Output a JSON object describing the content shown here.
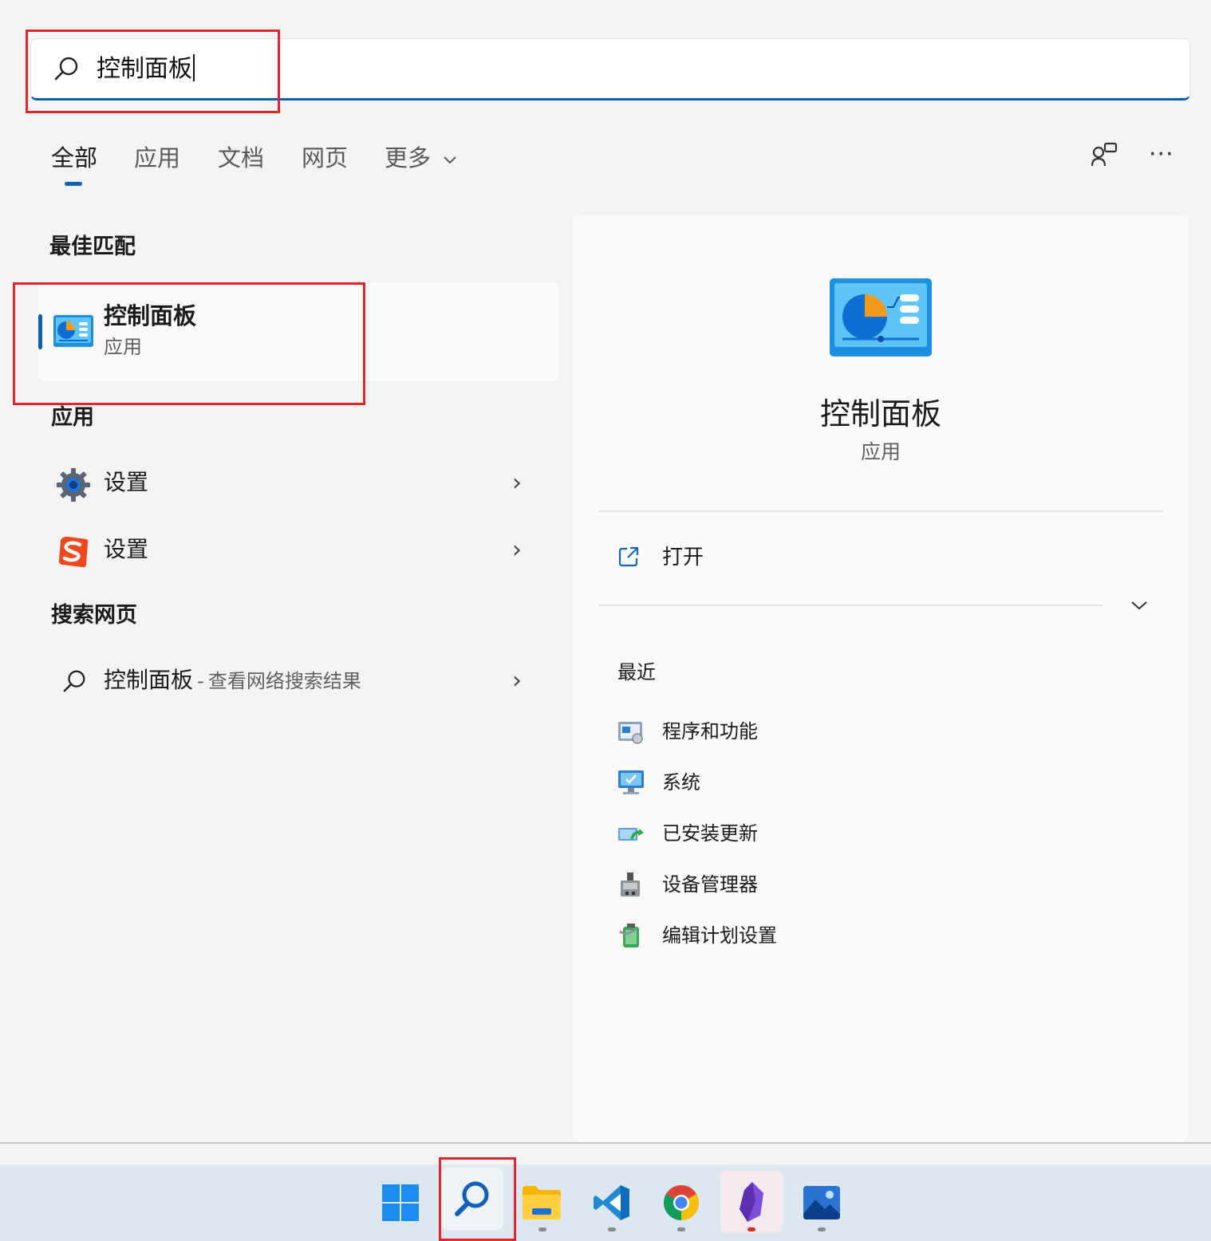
{
  "search": {
    "query": "控制面板"
  },
  "tabs": [
    {
      "label": "全部"
    },
    {
      "label": "应用"
    },
    {
      "label": "文档"
    },
    {
      "label": "网页"
    },
    {
      "label": "更多"
    }
  ],
  "sections": {
    "best_match": "最佳匹配",
    "apps": "应用",
    "web": "搜索网页"
  },
  "best_match": {
    "title": "控制面板",
    "subtitle": "应用"
  },
  "apps": [
    {
      "label": "设置",
      "icon": "settings-gear-icon"
    },
    {
      "label": "设置",
      "icon": "sogou-s-icon"
    }
  ],
  "web_result": {
    "query": "控制面板",
    "separator": "-",
    "suffix": "查看网络搜索结果"
  },
  "detail": {
    "title": "控制面板",
    "subtitle": "应用",
    "open_label": "打开",
    "recent_label": "最近",
    "recent": [
      {
        "label": "程序和功能",
        "icon": "programs-features-icon"
      },
      {
        "label": "系统",
        "icon": "system-monitor-icon"
      },
      {
        "label": "已安装更新",
        "icon": "installed-updates-icon"
      },
      {
        "label": "设备管理器",
        "icon": "device-manager-icon"
      },
      {
        "label": "编辑计划设置",
        "icon": "power-plan-icon"
      }
    ]
  },
  "colors": {
    "accent": "#0f5fb8",
    "annotation": "#e0262b"
  },
  "taskbar": [
    {
      "name": "start-button"
    },
    {
      "name": "search-button"
    },
    {
      "name": "file-explorer"
    },
    {
      "name": "vscode"
    },
    {
      "name": "chrome"
    },
    {
      "name": "obsidian"
    },
    {
      "name": "photos"
    }
  ]
}
